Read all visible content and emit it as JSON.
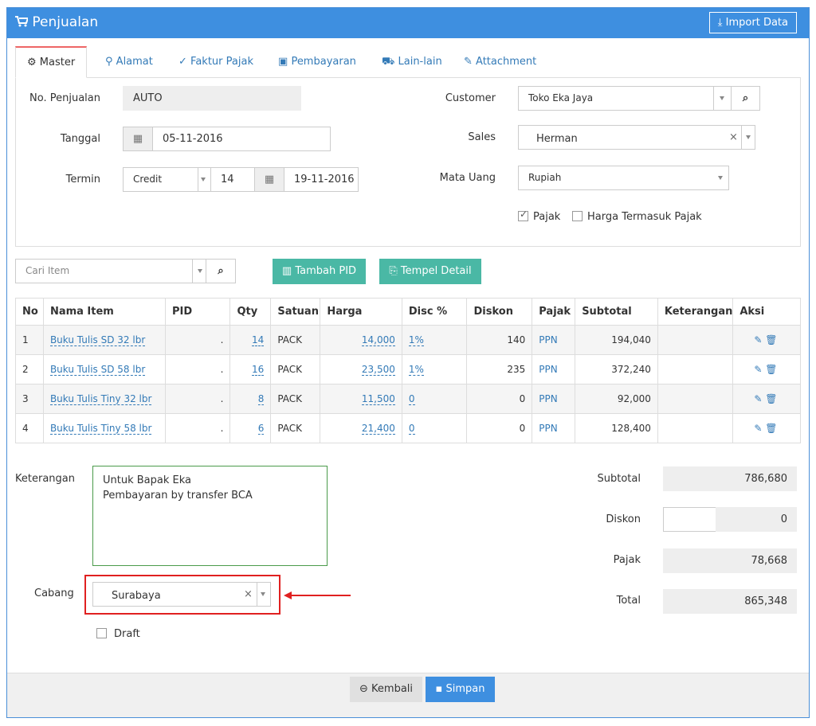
{
  "header": {
    "title": "Penjualan",
    "import_label": "Import Data"
  },
  "tabs": [
    "Master",
    "Alamat",
    "Faktur Pajak",
    "Pembayaran",
    "Lain-lain",
    "Attachment"
  ],
  "form": {
    "no_label": "No. Penjualan",
    "no_value": "AUTO",
    "tanggal_label": "Tanggal",
    "tanggal_value": "05-11-2016",
    "termin_label": "Termin",
    "termin_type": "Credit",
    "termin_days": "14",
    "termin_date": "19-11-2016",
    "customer_label": "Customer",
    "customer_value": "Toko Eka Jaya",
    "sales_label": "Sales",
    "sales_value": "Herman",
    "mata_uang_label": "Mata Uang",
    "mata_uang_value": "Rupiah",
    "pajak_label": "Pajak",
    "harga_pajak_label": "Harga Termasuk Pajak"
  },
  "toolbar": {
    "search_placeholder": "Cari Item",
    "tambah_pid": "Tambah PID",
    "tempel_detail": "Tempel Detail"
  },
  "table": {
    "headers": [
      "No",
      "Nama Item",
      "PID",
      "Qty",
      "Satuan",
      "Harga",
      "Disc %",
      "Diskon",
      "Pajak",
      "Subtotal",
      "Keterangan",
      "Aksi"
    ],
    "rows": [
      {
        "no": "1",
        "item": "Buku Tulis SD 32 lbr",
        "pid": ".",
        "qty": "14",
        "satuan": "PACK",
        "harga": "14,000",
        "disc": "1%",
        "diskon": "140",
        "pajak": "PPN",
        "subtotal": "194,040",
        "ket": ""
      },
      {
        "no": "2",
        "item": "Buku Tulis SD 58 lbr",
        "pid": ".",
        "qty": "16",
        "satuan": "PACK",
        "harga": "23,500",
        "disc": "1%",
        "diskon": "235",
        "pajak": "PPN",
        "subtotal": "372,240",
        "ket": ""
      },
      {
        "no": "3",
        "item": "Buku Tulis Tiny 32 lbr",
        "pid": ".",
        "qty": "8",
        "satuan": "PACK",
        "harga": "11,500",
        "disc": "0",
        "diskon": "0",
        "pajak": "PPN",
        "subtotal": "92,000",
        "ket": ""
      },
      {
        "no": "4",
        "item": "Buku Tulis Tiny 58 lbr",
        "pid": ".",
        "qty": "6",
        "satuan": "PACK",
        "harga": "21,400",
        "disc": "0",
        "diskon": "0",
        "pajak": "PPN",
        "subtotal": "128,400",
        "ket": ""
      }
    ]
  },
  "bottom": {
    "keterangan_label": "Keterangan",
    "keterangan_line1": "Untuk Bapak Eka",
    "keterangan_line2": "Pembayaran by transfer BCA",
    "cabang_label": "Cabang",
    "cabang_value": "Surabaya",
    "draft_label": "Draft"
  },
  "summary": {
    "subtotal_label": "Subtotal",
    "subtotal": "786,680",
    "diskon_label": "Diskon",
    "diskon": "0",
    "pajak_label": "Pajak",
    "pajak": "78,668",
    "total_label": "Total",
    "total": "865,348"
  },
  "footer": {
    "kembali": "Kembali",
    "simpan": "Simpan"
  }
}
